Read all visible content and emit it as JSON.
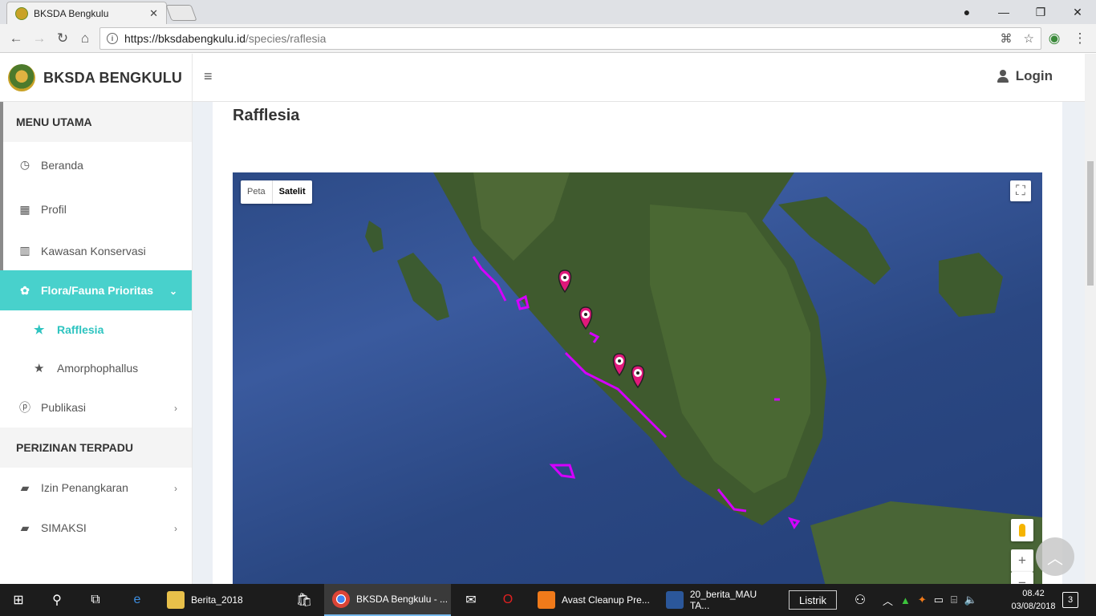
{
  "browser": {
    "tab_title": "BKSDA Bengkulu",
    "url_host": "https://bksdabengkulu.id",
    "url_path": "/species/raflesia"
  },
  "header": {
    "brand": "BKSDA BENGKULU",
    "login_label": "Login"
  },
  "sidebar": {
    "section_main": "MENU UTAMA",
    "items": [
      {
        "label": "Beranda",
        "icon": "dashboard-icon"
      },
      {
        "label": "Profil",
        "icon": "building-icon"
      },
      {
        "label": "Kawasan Konservasi",
        "icon": "map-icon"
      },
      {
        "label": "Flora/Fauna Prioritas",
        "icon": "gear-icon"
      }
    ],
    "sub_items": [
      {
        "label": "Rafflesia",
        "icon": "star-icon"
      },
      {
        "label": "Amorphophallus",
        "icon": "star-icon"
      }
    ],
    "publikasi": "Publikasi",
    "section_permits": "PERIZINAN TERPADU",
    "permit_items": [
      {
        "label": "Izin Penangkaran",
        "icon": "book-icon"
      },
      {
        "label": "SIMAKSI",
        "icon": "book-icon"
      }
    ]
  },
  "main": {
    "title": "Rafflesia",
    "map": {
      "type_map": "Peta",
      "type_satellite": "Satelit",
      "zoom_in": "+",
      "zoom_out": "−",
      "marker_count": 4
    }
  },
  "taskbar": {
    "apps": [
      {
        "label": "Berita_2018"
      },
      {
        "label": "BKSDA Bengkulu - ..."
      },
      {
        "label": "Avast Cleanup Pre..."
      },
      {
        "label": "20_berita_MAU TA..."
      }
    ],
    "listrik": "Listrik",
    "time": "08.42",
    "date": "03/08/2018",
    "notifications": "3"
  },
  "colors": {
    "accent": "#48d1cc",
    "marker": "#e0187a",
    "boundary": "#d400ff"
  }
}
